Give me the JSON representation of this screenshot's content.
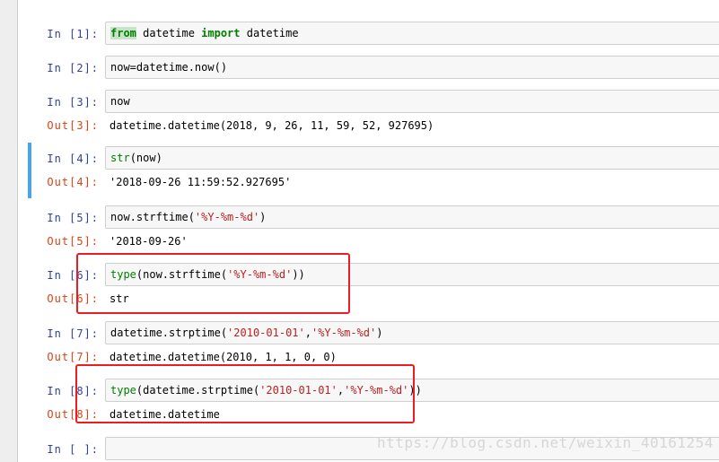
{
  "cells": [
    {
      "in_prompt": "In  [1]:",
      "code": {
        "kw1": "from",
        "mid": " datetime ",
        "kw2": "import",
        "tail": " datetime"
      }
    },
    {
      "in_prompt": "In  [2]:",
      "code": {
        "text": "now=datetime.now()"
      }
    },
    {
      "in_prompt": "In  [3]:",
      "code": {
        "text": "now"
      },
      "out_prompt": "Out[3]:",
      "output": "datetime.datetime(2018, 9, 26, 11, 59, 52, 927695)"
    },
    {
      "in_prompt": "In  [4]:",
      "code": {
        "fn": "str",
        "rest": "(now)"
      },
      "out_prompt": "Out[4]:",
      "output": "'2018-09-26 11:59:52.927695'"
    },
    {
      "in_prompt": "In  [5]:",
      "code": {
        "pre": "now.strftime(",
        "str": "'%Y-%m-%d'",
        "post": ")"
      },
      "out_prompt": "Out[5]:",
      "output": "'2018-09-26'"
    },
    {
      "in_prompt": "In  [6]:",
      "code": {
        "fn": "type",
        "pre": "(now.strftime(",
        "str": "'%Y-%m-%d'",
        "post": "))"
      },
      "out_prompt": "Out[6]:",
      "output": "str"
    },
    {
      "in_prompt": "In  [7]:",
      "code": {
        "pre": "datetime.strptime(",
        "str1": "'2010-01-01'",
        "comma": ",",
        "str2": "'%Y-%m-%d'",
        "post": ")"
      },
      "out_prompt": "Out[7]:",
      "output": "datetime.datetime(2010, 1, 1, 0, 0)"
    },
    {
      "in_prompt": "In  [8]:",
      "code": {
        "fn": "type",
        "pre": "(datetime.strptime(",
        "str1": "'2010-01-01'",
        "comma": ",",
        "str2": "'%Y-%m-%d'",
        "post": "))"
      },
      "out_prompt": "Out[8]:",
      "output": "datetime.datetime"
    },
    {
      "in_prompt": "In  [ ]:"
    }
  ],
  "watermark": "https://blog.csdn.net/weixin_40161254",
  "colors": {
    "in_prompt": "#303f9f",
    "out_prompt": "#d84315",
    "selected_bar": "#42a5f5",
    "highlight_box": "#ec1c24"
  }
}
